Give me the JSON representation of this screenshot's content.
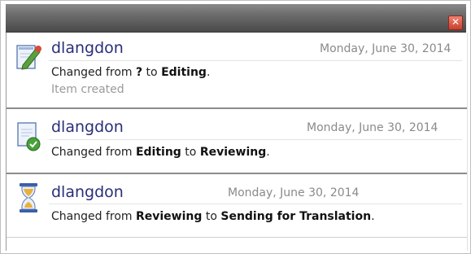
{
  "window": {
    "close_glyph": "✕"
  },
  "entries": [
    {
      "icon": "edit-document-icon",
      "user": "dlangdon",
      "date": "Monday, June 30, 2014",
      "change_prefix": "Changed from ",
      "from": "?",
      "to_word": " to ",
      "to": "Editing",
      "suffix": ".",
      "note": "Item created"
    },
    {
      "icon": "approved-document-icon",
      "user": "dlangdon",
      "date": "Monday, June 30, 2014",
      "change_prefix": "Changed from ",
      "from": "Editing",
      "to_word": " to ",
      "to": "Reviewing",
      "suffix": "."
    },
    {
      "icon": "hourglass-icon",
      "user": "dlangdon",
      "date": "Monday, June 30, 2014",
      "change_prefix": "Changed from ",
      "from": "Reviewing",
      "to_word": " to ",
      "to": "Sending for Translation",
      "suffix": "."
    }
  ]
}
